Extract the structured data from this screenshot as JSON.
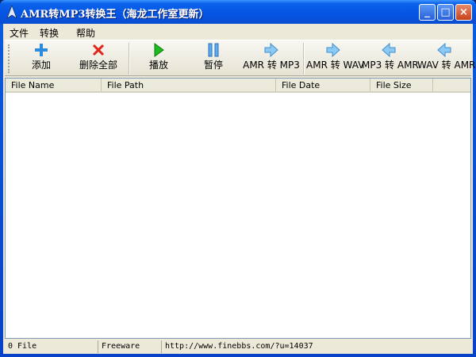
{
  "window": {
    "title": "AMR转MP3转换王（海龙工作室更新）",
    "min": "_",
    "max": "□",
    "close": "×"
  },
  "menu": [
    "文件",
    "转换",
    "帮助"
  ],
  "toolbar": [
    {
      "label": "添加",
      "icon": "plus-icon"
    },
    {
      "label": "删除全部",
      "icon": "delete-x-icon"
    },
    {
      "label": "播放",
      "icon": "play-icon"
    },
    {
      "label": "暂停",
      "icon": "pause-icon"
    },
    {
      "label": "AMR 转 MP3",
      "icon": "arrow-right-icon"
    },
    {
      "label": "AMR 转 WAV",
      "icon": "arrow-right-icon"
    },
    {
      "label": "MP3 转 AMR",
      "icon": "arrow-left-icon"
    },
    {
      "label": "WAV 转 AMR",
      "icon": "arrow-left-icon"
    }
  ],
  "columns": [
    "File Name",
    "File Path",
    "File Date",
    "File Size"
  ],
  "status": {
    "count": "0 File",
    "license": "Freeware",
    "url": "http://www.finebbs.com/?u=14037"
  }
}
